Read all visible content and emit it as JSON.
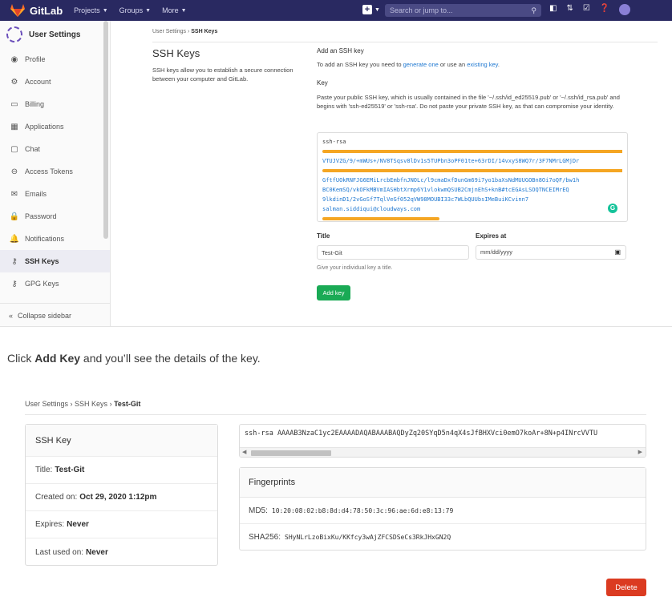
{
  "topbar": {
    "brand": "GitLab",
    "nav": [
      "Projects",
      "Groups",
      "More"
    ],
    "search_placeholder": "Search or jump to..."
  },
  "sidebar": {
    "title": "User Settings",
    "items": [
      {
        "label": "Profile",
        "icon": "profile-icon"
      },
      {
        "label": "Account",
        "icon": "account-icon"
      },
      {
        "label": "Billing",
        "icon": "billing-icon"
      },
      {
        "label": "Applications",
        "icon": "applications-icon"
      },
      {
        "label": "Chat",
        "icon": "chat-icon"
      },
      {
        "label": "Access Tokens",
        "icon": "token-icon"
      },
      {
        "label": "Emails",
        "icon": "email-icon"
      },
      {
        "label": "Password",
        "icon": "lock-icon"
      },
      {
        "label": "Notifications",
        "icon": "bell-icon"
      },
      {
        "label": "SSH Keys",
        "icon": "key-icon",
        "active": true
      },
      {
        "label": "GPG Keys",
        "icon": "key-icon"
      }
    ],
    "collapse_label": "Collapse sidebar"
  },
  "settings": {
    "breadcrumb_root": "User Settings",
    "breadcrumb_current": "SSH Keys",
    "heading": "SSH Keys",
    "description": "SSH keys allow you to establish a secure connection between your computer and GitLab.",
    "add_title": "Add an SSH key",
    "add_text_pre": "To add an SSH key you need to ",
    "add_link1": "generate one",
    "add_text_mid": " or use an ",
    "add_link2": "existing key",
    "add_text_post": ".",
    "key_label": "Key",
    "key_help": "Paste your public SSH key, which is usually contained in the file '~/.ssh/id_ed25519.pub' or '~/.ssh/id_rsa.pub' and begins with 'ssh-ed25519' or 'ssh-rsa'. Do not paste your private SSH key, as that can compromise your identity.",
    "key_value_lines": [
      "ssh-rsa",
      "VTUJVZG/9/+mWUs+/NV8TSqsv8lDv1s5TUPbn3oPF01te+63rDI/14vxyS8WQ7r/3F7NMrLGMjDr",
      "GftfUOkRNFJG6EMiLrcbEmbfnJNOLc/l9cmaDxfDunGm69i7yo1baXsNdMUUGOBn8Oi7oQF/bw1h",
      "BC0KemSQ/vkOFkMBVmIASHbtXrmp6Y1vlokwmQSUB2CmjnEhS+knB#tcEGAsLSOQTNCEIMrEQ",
      "9lkdinD1/2vGoSf7TqlVeGf052qVW98MOUBI33c7WLbQUUbsIMeBuiKCvinn7",
      "salman.siddiqui@cloudways.com"
    ],
    "title_label": "Title",
    "title_value": "Test-Git",
    "expires_label": "Expires at",
    "expires_placeholder": "mm/dd/yyyy",
    "title_hint": "Give your individual key a title.",
    "add_key_button": "Add key"
  },
  "caption": {
    "pre": "Click ",
    "bold": "Add Key",
    "post": " and you’ll see the details of the key."
  },
  "details": {
    "breadcrumb_root": "User Settings",
    "breadcrumb_mid": "SSH Keys",
    "breadcrumb_current": "Test-Git",
    "card_title": "SSH Key",
    "title_label": "Title:",
    "title_value": "Test-Git",
    "created_label": "Created on:",
    "created_value": "Oct 29, 2020 1:12pm",
    "expires_label": "Expires:",
    "expires_value": "Never",
    "last_used_label": "Last used on:",
    "last_used_value": "Never",
    "key_text": "ssh-rsa AAAAB3NzaC1yc2EAAAADAQABAAABAQDyZq20SYqD5n4qX4sJfBHXVci0emO7koAr+8N+p4INrcVVTU",
    "fingerprints_title": "Fingerprints",
    "md5_label": "MD5:",
    "md5_value": "10:20:08:02:b8:8d:d4:78:50:3c:96:ae:6d:e8:13:79",
    "sha_label": "SHA256:",
    "sha_value": "SHyNLrLzoBixKu/KKfcy3wAjZFCSDSeCs3RkJHxGN2Q",
    "delete_button": "Delete"
  },
  "colors": {
    "navbar": "#292961",
    "active_item": "#ececf3",
    "link": "#1f78d1",
    "add_button": "#1aaa55",
    "delete_button": "#db3b21",
    "highlight": "#f5a623"
  }
}
